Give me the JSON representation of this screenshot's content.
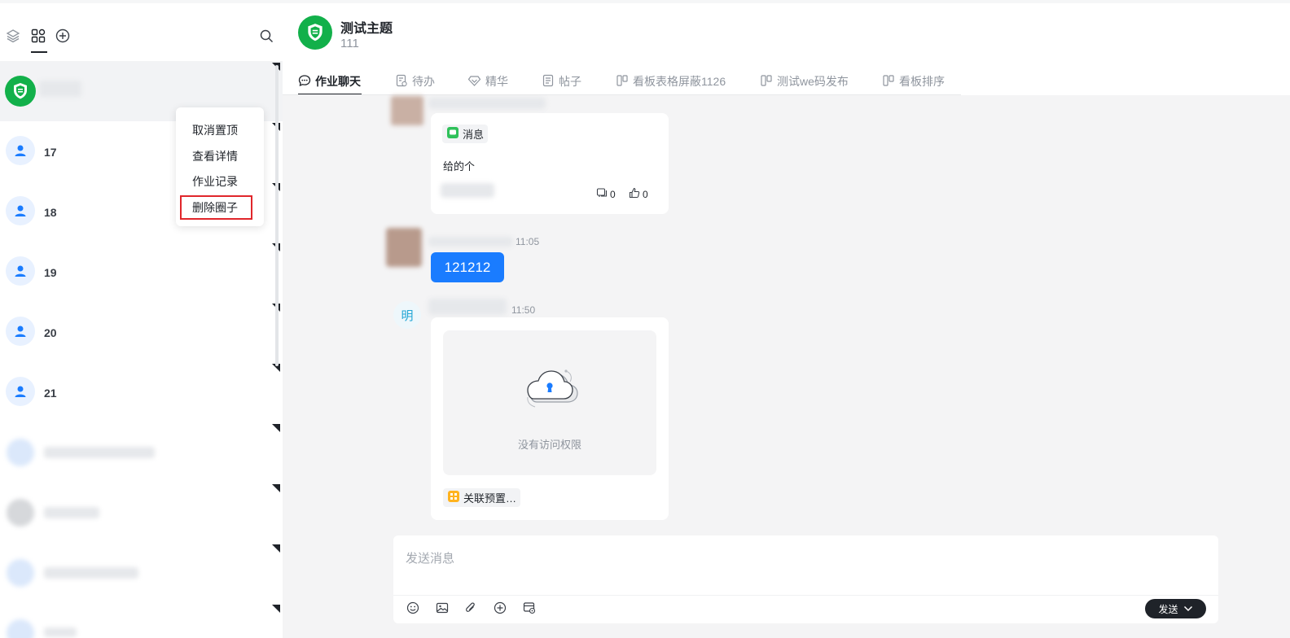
{
  "sidebar": {
    "toolbar_icons": [
      "layers-icon",
      "grid-apps-icon",
      "plus-circle-icon",
      "search-icon"
    ],
    "conversations": [
      {
        "label": "",
        "avatar": "green-shield-logo",
        "active": true
      },
      {
        "label": "17",
        "avatar": "user-icon"
      },
      {
        "label": "18",
        "avatar": "user-icon"
      },
      {
        "label": "19",
        "avatar": "user-icon"
      },
      {
        "label": "20",
        "avatar": "user-icon"
      },
      {
        "label": "21",
        "avatar": "user-icon"
      }
    ],
    "context_menu": {
      "items": [
        "取消置顶",
        "查看详情",
        "作业记录",
        "删除圈子"
      ],
      "highlighted": "删除圈子"
    }
  },
  "header": {
    "title": "测试主题",
    "subtitle": "111",
    "tabs": [
      {
        "label": "作业聊天",
        "icon": "chat-bubble-icon",
        "active": true
      },
      {
        "label": "待办",
        "icon": "todo-doc-icon"
      },
      {
        "label": "精华",
        "icon": "diamond-icon"
      },
      {
        "label": "帖子",
        "icon": "post-doc-icon"
      },
      {
        "label": "看板表格屏蔽1126",
        "icon": "kanban-icon"
      },
      {
        "label": "测试we码发布",
        "icon": "kanban-icon"
      },
      {
        "label": "看板排序",
        "icon": "kanban-icon"
      }
    ]
  },
  "messages": {
    "card1": {
      "tag": "消息",
      "text": "给的个",
      "comments": "0",
      "likes": "0"
    },
    "msg2": {
      "time": "11:05",
      "text": "121212"
    },
    "msg3": {
      "avatar_char": "明",
      "time": "11:50",
      "no_access": "没有访问权限",
      "linked_tag": "关联预置…"
    }
  },
  "composer": {
    "placeholder": "发送消息",
    "tool_icons": [
      "emoji-icon",
      "image-icon",
      "attachment-icon",
      "plus-circle-icon",
      "card-settings-icon"
    ],
    "send_label": "发送"
  },
  "colors": {
    "accent": "#1a7cff",
    "brand_green": "#12b04a",
    "highlight_red": "#e0262b",
    "dark": "#1f2329"
  }
}
